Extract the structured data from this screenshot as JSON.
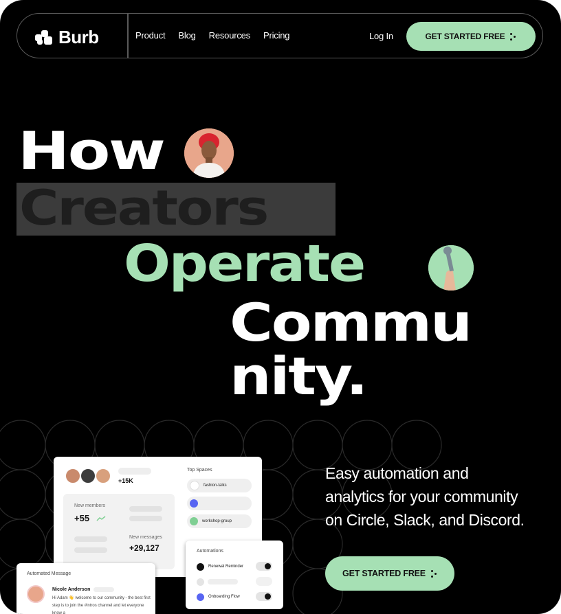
{
  "nav": {
    "logo": "Burb",
    "links": [
      "Product",
      "Blog",
      "Resources",
      "Pricing"
    ],
    "login": "Log In",
    "cta": "GET STARTED FREE"
  },
  "hero": {
    "line1": "How",
    "line2": "Creators",
    "line3": "Operate",
    "line4": "Commu",
    "line5": "nity.",
    "tagline": [
      "Easy automation and",
      "analytics for your community",
      "on Circle, Slack, and Discord."
    ],
    "cta": "GET STARTED FREE"
  },
  "dashboard": {
    "member_count": "+15K",
    "new_members_label": "New members",
    "new_members_value": "+55",
    "new_messages_label": "New messages",
    "new_messages_value": "+29,127",
    "top_spaces_title": "Top Spaces",
    "spaces": [
      "fashion-talks",
      "",
      "workshop-group"
    ],
    "automations_title": "Automations",
    "automations": [
      "Renewal Reminder",
      "",
      "Onboarding Flow"
    ],
    "automated_message_title": "Automated Message",
    "message_sender": "Nicole Anderson",
    "message_body": "Hi Adam 👋 welcome to our community - the best first step is to join the #intros channel and let everyone know a"
  },
  "colors": {
    "background": "#000000",
    "accent_green": "#a6e0b4",
    "highlight_gray": "#3b3b3b",
    "white": "#ffffff"
  },
  "icons": [
    "burb-logo-icon",
    "arrow-dots-icon",
    "trend-up-icon",
    "wrench-icon"
  ]
}
